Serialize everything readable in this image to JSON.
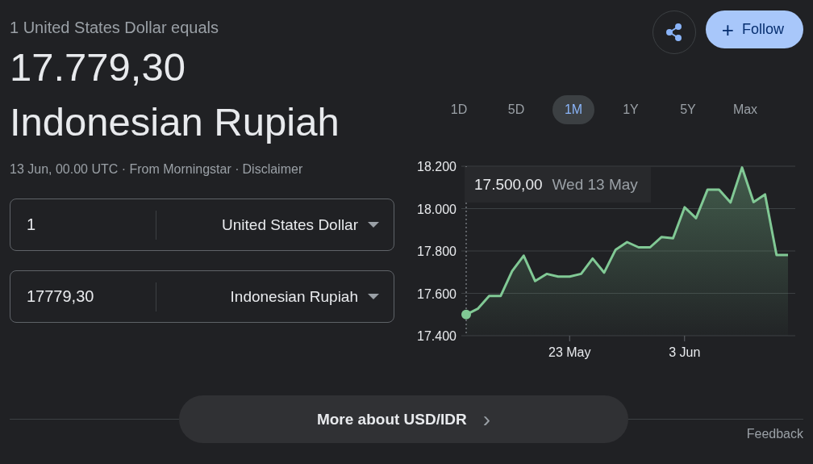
{
  "headline": "1 United States Dollar equals",
  "rate": "17.779,30",
  "target_currency": "Indonesian Rupiah",
  "source": {
    "text": "13 Jun, 00.00 UTC · From Morningstar ·",
    "link": "Disclaimer"
  },
  "converter": [
    {
      "amount": "1",
      "currency": "United States Dollar"
    },
    {
      "amount": "17779,30",
      "currency": "Indonesian Rupiah"
    }
  ],
  "follow_button": {
    "icon": "+",
    "label": "Follow"
  },
  "ranges": [
    {
      "label": "1D",
      "selected": false
    },
    {
      "label": "5D",
      "selected": false
    },
    {
      "label": "1M",
      "selected": true
    },
    {
      "label": "1Y",
      "selected": false
    },
    {
      "label": "5Y",
      "selected": false
    },
    {
      "label": "Max",
      "selected": false
    }
  ],
  "chart": {
    "tooltip": {
      "value": "17.500,00",
      "date": "Wed 13 May"
    },
    "chart_data": {
      "type": "area",
      "categories": [
        null,
        null,
        null,
        null,
        null,
        null,
        null,
        null,
        null,
        "23 May",
        null,
        null,
        null,
        null,
        null,
        null,
        null,
        null,
        null,
        "3 Jun",
        null,
        null,
        null,
        null,
        null,
        null,
        null,
        null,
        null
      ],
      "series": [
        {
          "color": "#81c995",
          "values": [
            17500,
            17527,
            17588,
            17588,
            17705,
            17778,
            17658,
            17692,
            17679,
            17679,
            17692,
            17764,
            17698,
            17806,
            17842,
            17817,
            17817,
            17866,
            17860,
            18006,
            17955,
            18090,
            18090,
            18029,
            18194,
            18031,
            18067,
            17781,
            17781
          ]
        }
      ],
      "ylim": [
        17400,
        18200
      ],
      "grid": true,
      "yticks": [
        {
          "value": 17400,
          "label": "17.400"
        },
        {
          "value": 17600,
          "label": "17.600"
        },
        {
          "value": 17800,
          "label": "17.800"
        },
        {
          "value": 18000,
          "label": "18.000"
        },
        {
          "value": 18200,
          "label": "18.200"
        }
      ]
    }
  },
  "more_button": {
    "label": "More about USD/IDR",
    "icon": "›"
  },
  "feedback": "Feedback"
}
